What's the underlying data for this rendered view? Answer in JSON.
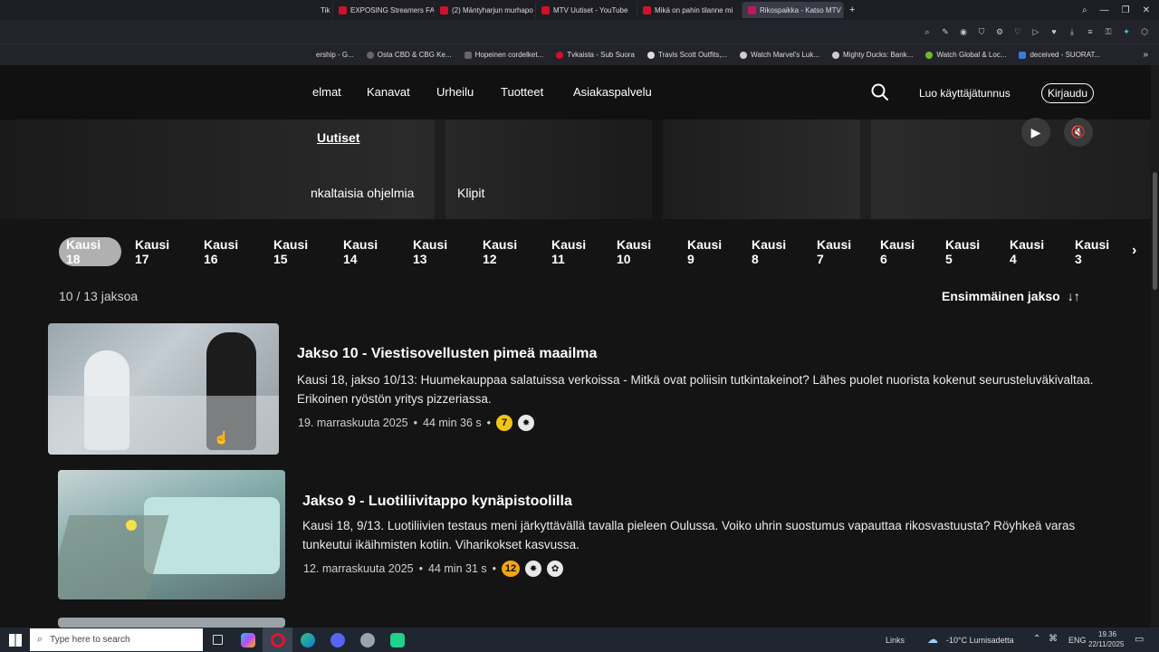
{
  "browser": {
    "tabs": [
      {
        "label": "Tik"
      },
      {
        "label": "EXPOSING Streamers FAKI"
      },
      {
        "label": "(2) Mäntyharjun murhapo"
      },
      {
        "label": "MTV Uutiset - YouTube"
      },
      {
        "label": "Mikä on pahin tilanne mi"
      },
      {
        "label": "Rikospaikka - Katso MTV"
      }
    ],
    "new_tab_label": "+",
    "bookmarks": [
      {
        "label": "ership - G..."
      },
      {
        "label": "Osta CBD & CBG Ke..."
      },
      {
        "label": "Hopeinen cordelket..."
      },
      {
        "label": "Tvkaista - Sub Suora"
      },
      {
        "label": "Travis Scott Outfits,..."
      },
      {
        "label": "Watch Marvel's Luk..."
      },
      {
        "label": "Mighty Ducks: Bank..."
      },
      {
        "label": "Watch Global & Loc..."
      },
      {
        "label": "deceived - SUORAT..."
      }
    ]
  },
  "site": {
    "nav": [
      "elmat",
      "Kanavat",
      "Urheilu",
      "Tuotteet",
      "Asiakaspalvelu"
    ],
    "create_account": "Luo käyttäjätunnus",
    "login": "Kirjaudu",
    "hero_link": "Uutiset",
    "subnav": [
      "nkaltaisia ohjelmia",
      "Klipit"
    ]
  },
  "seasons": [
    "Kausi 18",
    "Kausi 17",
    "Kausi 16",
    "Kausi 15",
    "Kausi 14",
    "Kausi 13",
    "Kausi 12",
    "Kausi 11",
    "Kausi 10",
    "Kausi 9",
    "Kausi 8",
    "Kausi 7",
    "Kausi 6",
    "Kausi 5",
    "Kausi 4",
    "Kausi 3"
  ],
  "seasons_active_index": 0,
  "episode_count": "10 / 13 jaksoa",
  "sort_label": "Ensimmäinen jakso",
  "episodes": [
    {
      "title": "Jakso 10 - Viestisovellusten pimeä maailma",
      "description": "Kausi 18, jakso 10/13: Huumekauppaa salatuissa verkoissa - Mitkä ovat poliisin tutkintakeinot? Lähes puolet nuorista kokenut seurusteluväkivaltaa. Erikoinen ryöstön yritys pizzeriassa.",
      "date": "19. marraskuuta 2025",
      "duration": "44 min 36 s",
      "age_rating": "7",
      "age_color": "#f2c416"
    },
    {
      "title": "Jakso 9 - Luotiliivitappo kynäpistoolilla",
      "description": "Kausi 18, 9/13. Luotiliivien testaus meni järkyttävällä tavalla pieleen Oulussa. Voiko uhrin suostumus vapauttaa rikosvastuusta? Röyhkeä varas tunkeutui ikäihmisten kotiin. Viharikokset kasvussa.",
      "date": "12. marraskuuta 2025",
      "duration": "44 min 31 s",
      "age_rating": "12",
      "age_color": "#f2a516"
    }
  ],
  "taskbar": {
    "search_placeholder": "Type here to search",
    "links_label": "Links",
    "weather": "-10°C  Lumisadetta",
    "language": "ENG",
    "time": "19.36",
    "date": "22/11/2025"
  },
  "colors": {
    "accent_red": "#d0112b",
    "background": "#141414"
  }
}
